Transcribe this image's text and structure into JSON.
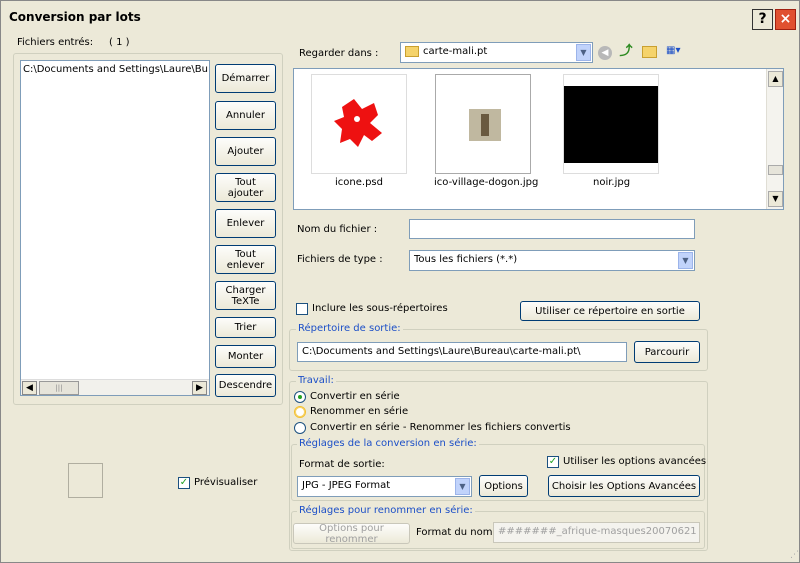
{
  "window": {
    "title": "Conversion par lots",
    "help": "?",
    "close": "×"
  },
  "left": {
    "files_label": "Fichiers entrés:",
    "files_count": "( 1 )",
    "file_items": [
      "C:\\Documents and Settings\\Laure\\Bu"
    ],
    "buttons": {
      "start": "Démarrer",
      "cancel": "Annuler",
      "add": "Ajouter",
      "add_all": "Tout ajouter",
      "remove": "Enlever",
      "remove_all": "Tout enlever",
      "load_text": "Charger TeXTe",
      "sort": "Trier",
      "up": "Monter",
      "down": "Descendre"
    },
    "preview_label": "Prévisualiser",
    "scroll_thumb": "|||"
  },
  "browser": {
    "look_in_label": "Regarder dans :",
    "look_in_value": "carte-mali.pt",
    "files": [
      {
        "name": "icone.psd"
      },
      {
        "name": "ico-village-dogon.jpg"
      },
      {
        "name": "noir.jpg"
      }
    ],
    "filename_label": "Nom du fichier :",
    "filename_value": "",
    "filetype_label": "Fichiers de type :",
    "filetype_value": "Tous les fichiers (*.*)"
  },
  "options": {
    "include_subdirs": "Inclure les sous-répertoires",
    "use_dir_output": "Utiliser ce répertoire en sortie",
    "output_dir_legend": "Répertoire de sortie:",
    "output_dir_value": "C:\\Documents and Settings\\Laure\\Bureau\\carte-mali.pt\\",
    "browse": "Parcourir",
    "work_legend": "Travail:",
    "work_options": [
      "Convertir en série",
      "Renommer en série",
      "Convertir en série - Renommer les fichiers convertis"
    ],
    "conv_legend": "Réglages de la conversion en série:",
    "output_format_label": "Format de sortie:",
    "output_format_value": "JPG - JPEG Format",
    "options_button": "Options",
    "advanced_check": "Utiliser les options avancées",
    "advanced_button": "Choisir les Options Avancées",
    "rename_legend": "Réglages pour renommer en série:",
    "rename_options_button": "Options pour renommer",
    "name_format_label": "Format du nom:",
    "name_format_value": "#######_afrique-masques20070621"
  }
}
